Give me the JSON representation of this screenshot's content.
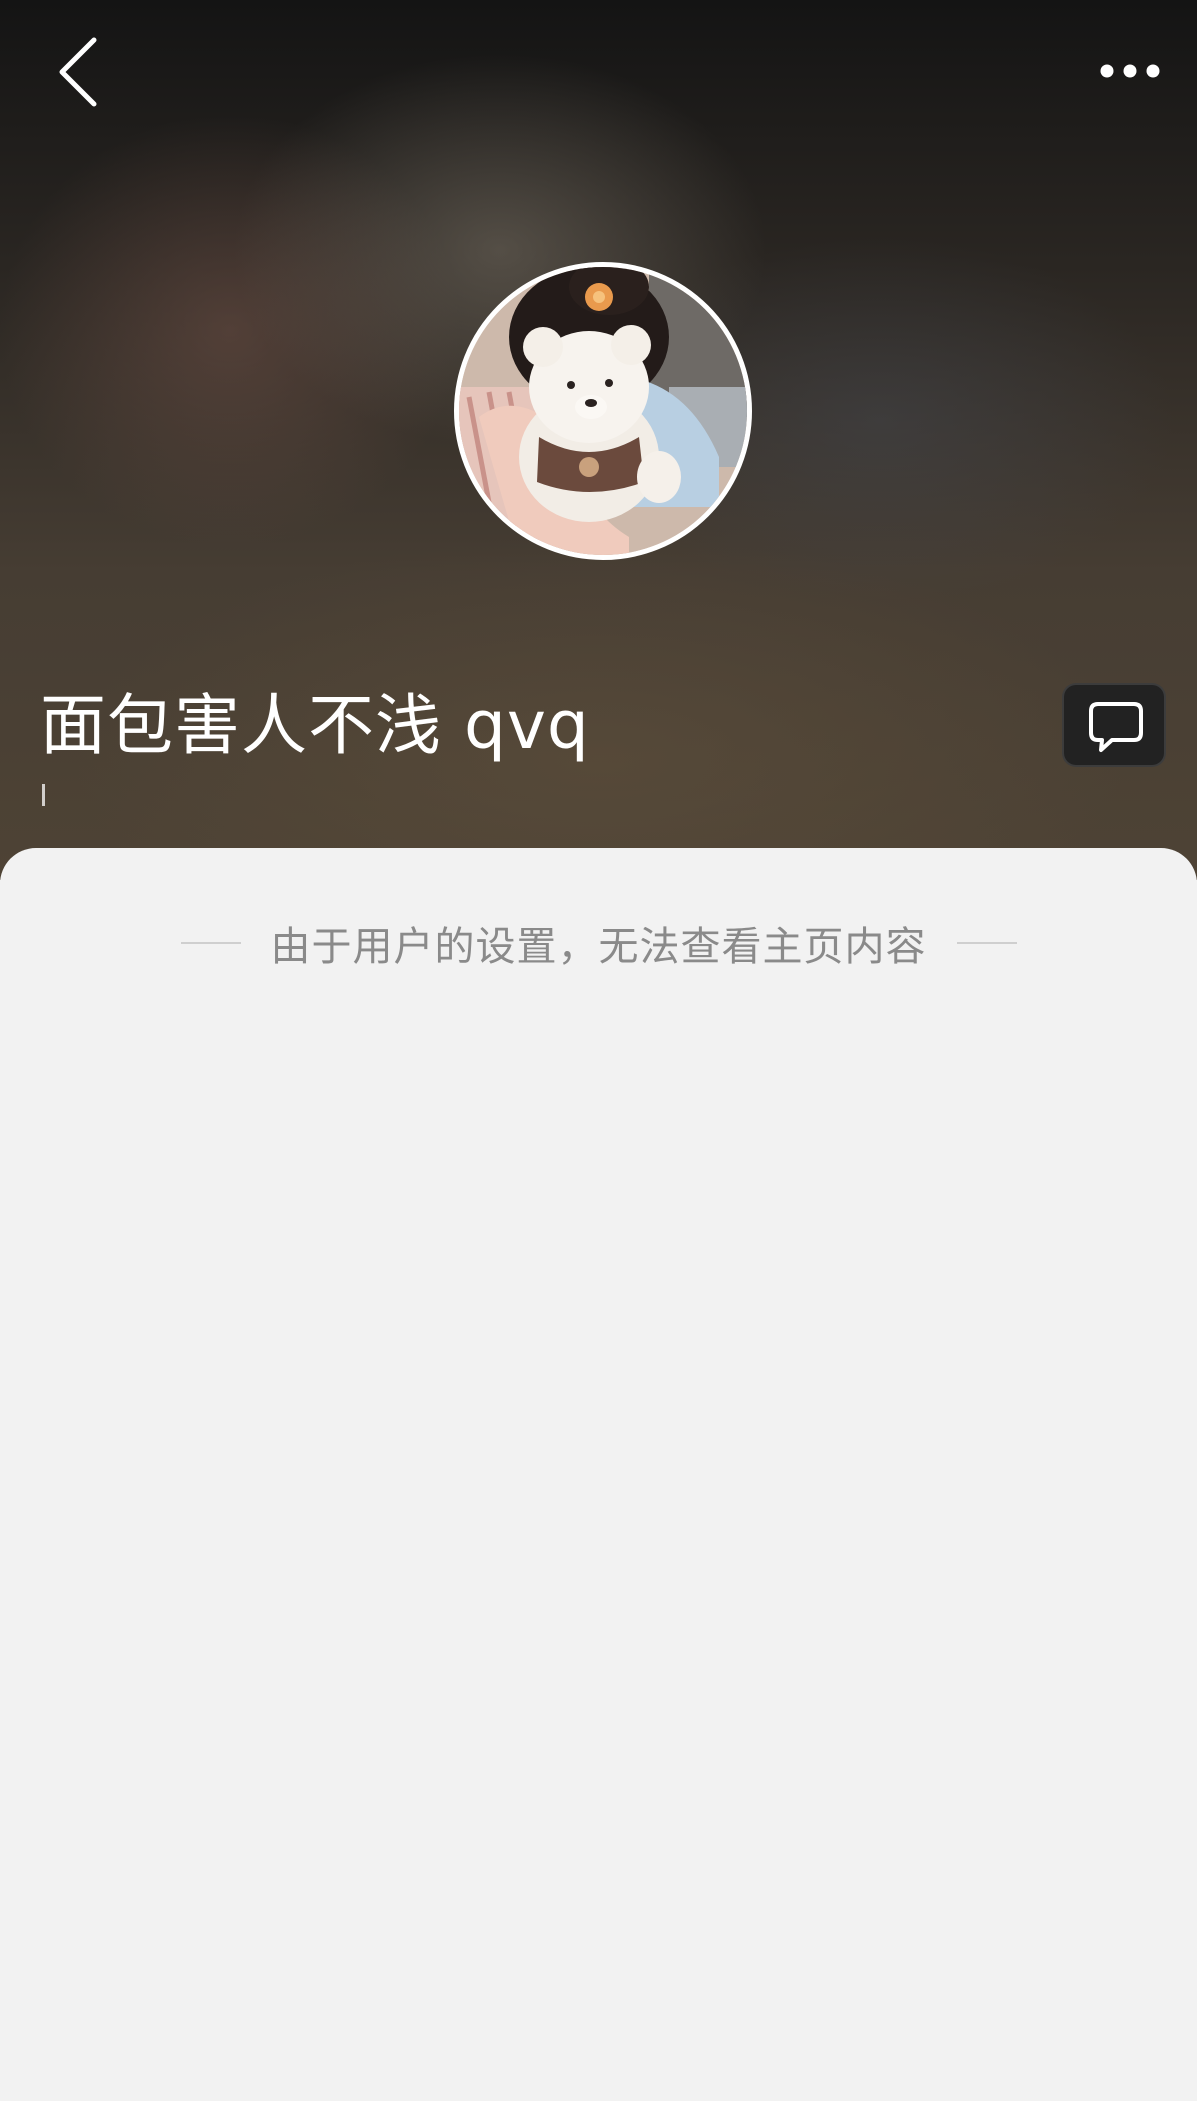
{
  "header": {
    "back_icon": "chevron-left-icon",
    "more_icon": "more-horizontal-icon",
    "username": "面包害人不浅 qvq",
    "bio": "",
    "chat_icon": "chat-bubble-icon"
  },
  "profile": {
    "avatar": "avatar-photo-girl-with-teddy-bear"
  },
  "content": {
    "notice": "由于用户的设置，无法查看主页内容"
  },
  "colors": {
    "background": "#f2f2f2",
    "header_dark": "#141414",
    "header_warm": "#4e4335",
    "notice_text": "#8a8a8a",
    "white": "#ffffff"
  }
}
